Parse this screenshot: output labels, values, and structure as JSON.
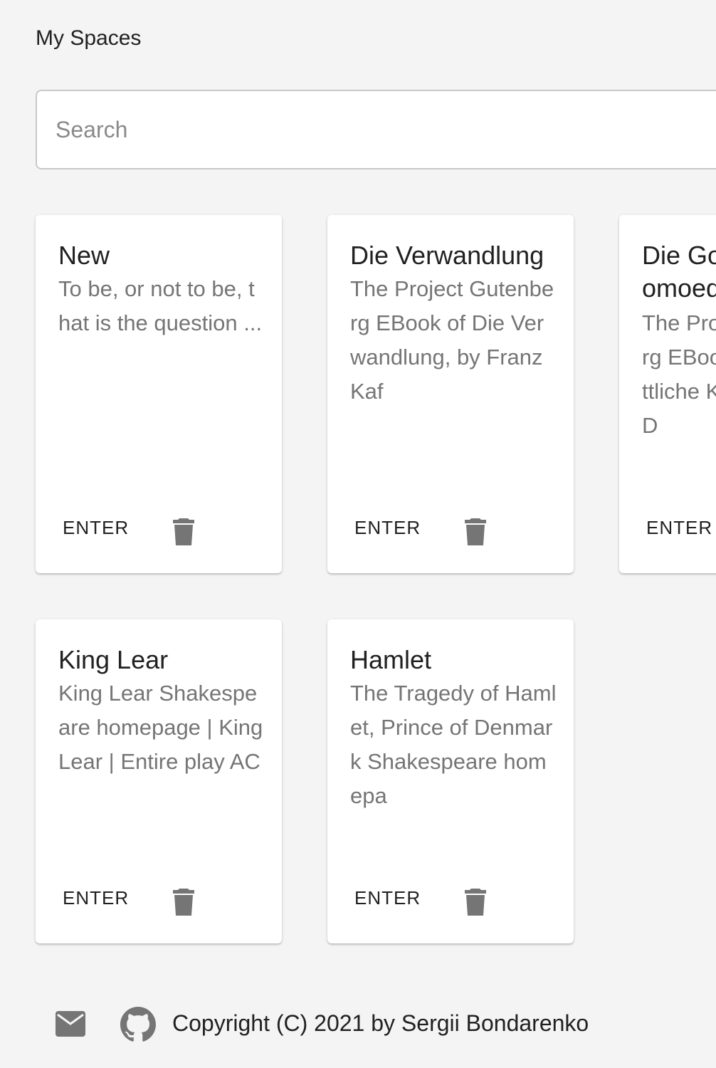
{
  "header": {
    "title": "My Spaces"
  },
  "search": {
    "placeholder": "Search",
    "value": ""
  },
  "spaces": [
    {
      "title": "New",
      "preview": "To be, or not to be, that is the question ...",
      "enter_label": "ENTER",
      "delete_icon": "trash-icon"
    },
    {
      "title": "Die Verwandlung",
      "preview": "The Project Gutenberg EBook of Die Verwandlung, by Franz Kaf",
      "enter_label": "ENTER",
      "delete_icon": "trash-icon"
    },
    {
      "title": "Die Goettliche Komoedie",
      "preview": "The Project Gutenberg EBook of Die Goettliche Komoedie, by D",
      "enter_label": "ENTER",
      "delete_icon": "trash-icon"
    },
    {
      "title": "King Lear",
      "preview": "King Lear Shakespeare homepage | King Lear | Entire play AC",
      "enter_label": "ENTER",
      "delete_icon": "trash-icon"
    },
    {
      "title": "Hamlet",
      "preview": "The Tragedy of Hamlet, Prince of Denmark Shakespeare homepa",
      "enter_label": "ENTER",
      "delete_icon": "trash-icon"
    }
  ],
  "footer": {
    "mail_icon": "mail-icon",
    "github_icon": "github-icon",
    "copyright": "Copyright (C) 2021 by Sergii Bondarenko"
  },
  "colors": {
    "background": "#f4f4f4",
    "card": "#ffffff",
    "title_text": "#212121",
    "secondary_text": "#757575",
    "icon": "#757575"
  }
}
